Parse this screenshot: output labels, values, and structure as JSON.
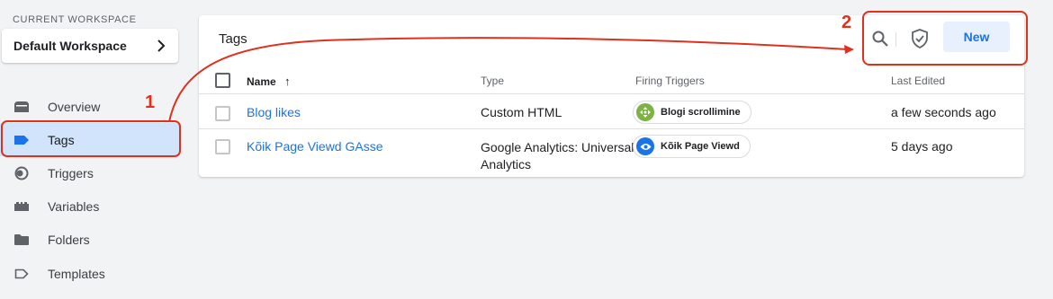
{
  "sidebar": {
    "workspace_label": "CURRENT WORKSPACE",
    "workspace_name": "Default Workspace",
    "items": [
      {
        "label": "Overview",
        "icon": "overview-icon"
      },
      {
        "label": "Tags",
        "icon": "tag-icon",
        "active": true
      },
      {
        "label": "Triggers",
        "icon": "trigger-icon"
      },
      {
        "label": "Variables",
        "icon": "variables-icon"
      },
      {
        "label": "Folders",
        "icon": "folder-icon"
      },
      {
        "label": "Templates",
        "icon": "template-icon"
      }
    ]
  },
  "main": {
    "title": "Tags",
    "new_label": "New",
    "columns": {
      "name": "Name",
      "sort_arrow": "↑",
      "type": "Type",
      "firing": "Firing Triggers",
      "edited": "Last Edited"
    },
    "rows": [
      {
        "name": "Blog likes",
        "type": "Custom HTML",
        "trigger": "Blogi scrollimine",
        "trigger_icon": "scroll-icon",
        "trigger_color": "#7cb342",
        "edited": "a few seconds ago"
      },
      {
        "name": "Kõik Page Viewd GAsse",
        "type_line1": "Google Analytics: Universal",
        "type_line2": "Analytics",
        "trigger": "Kõik Page Viewd",
        "trigger_icon": "eye-icon",
        "trigger_color": "#1a73e8",
        "edited": "5 days ago"
      }
    ]
  },
  "annotations": {
    "step1": "1",
    "step2": "2",
    "color": "#e0301e"
  },
  "colors": {
    "accent": "#1a73e8",
    "active_nav": "#d2e3fc",
    "new_button_bg": "#e8f0fe"
  }
}
